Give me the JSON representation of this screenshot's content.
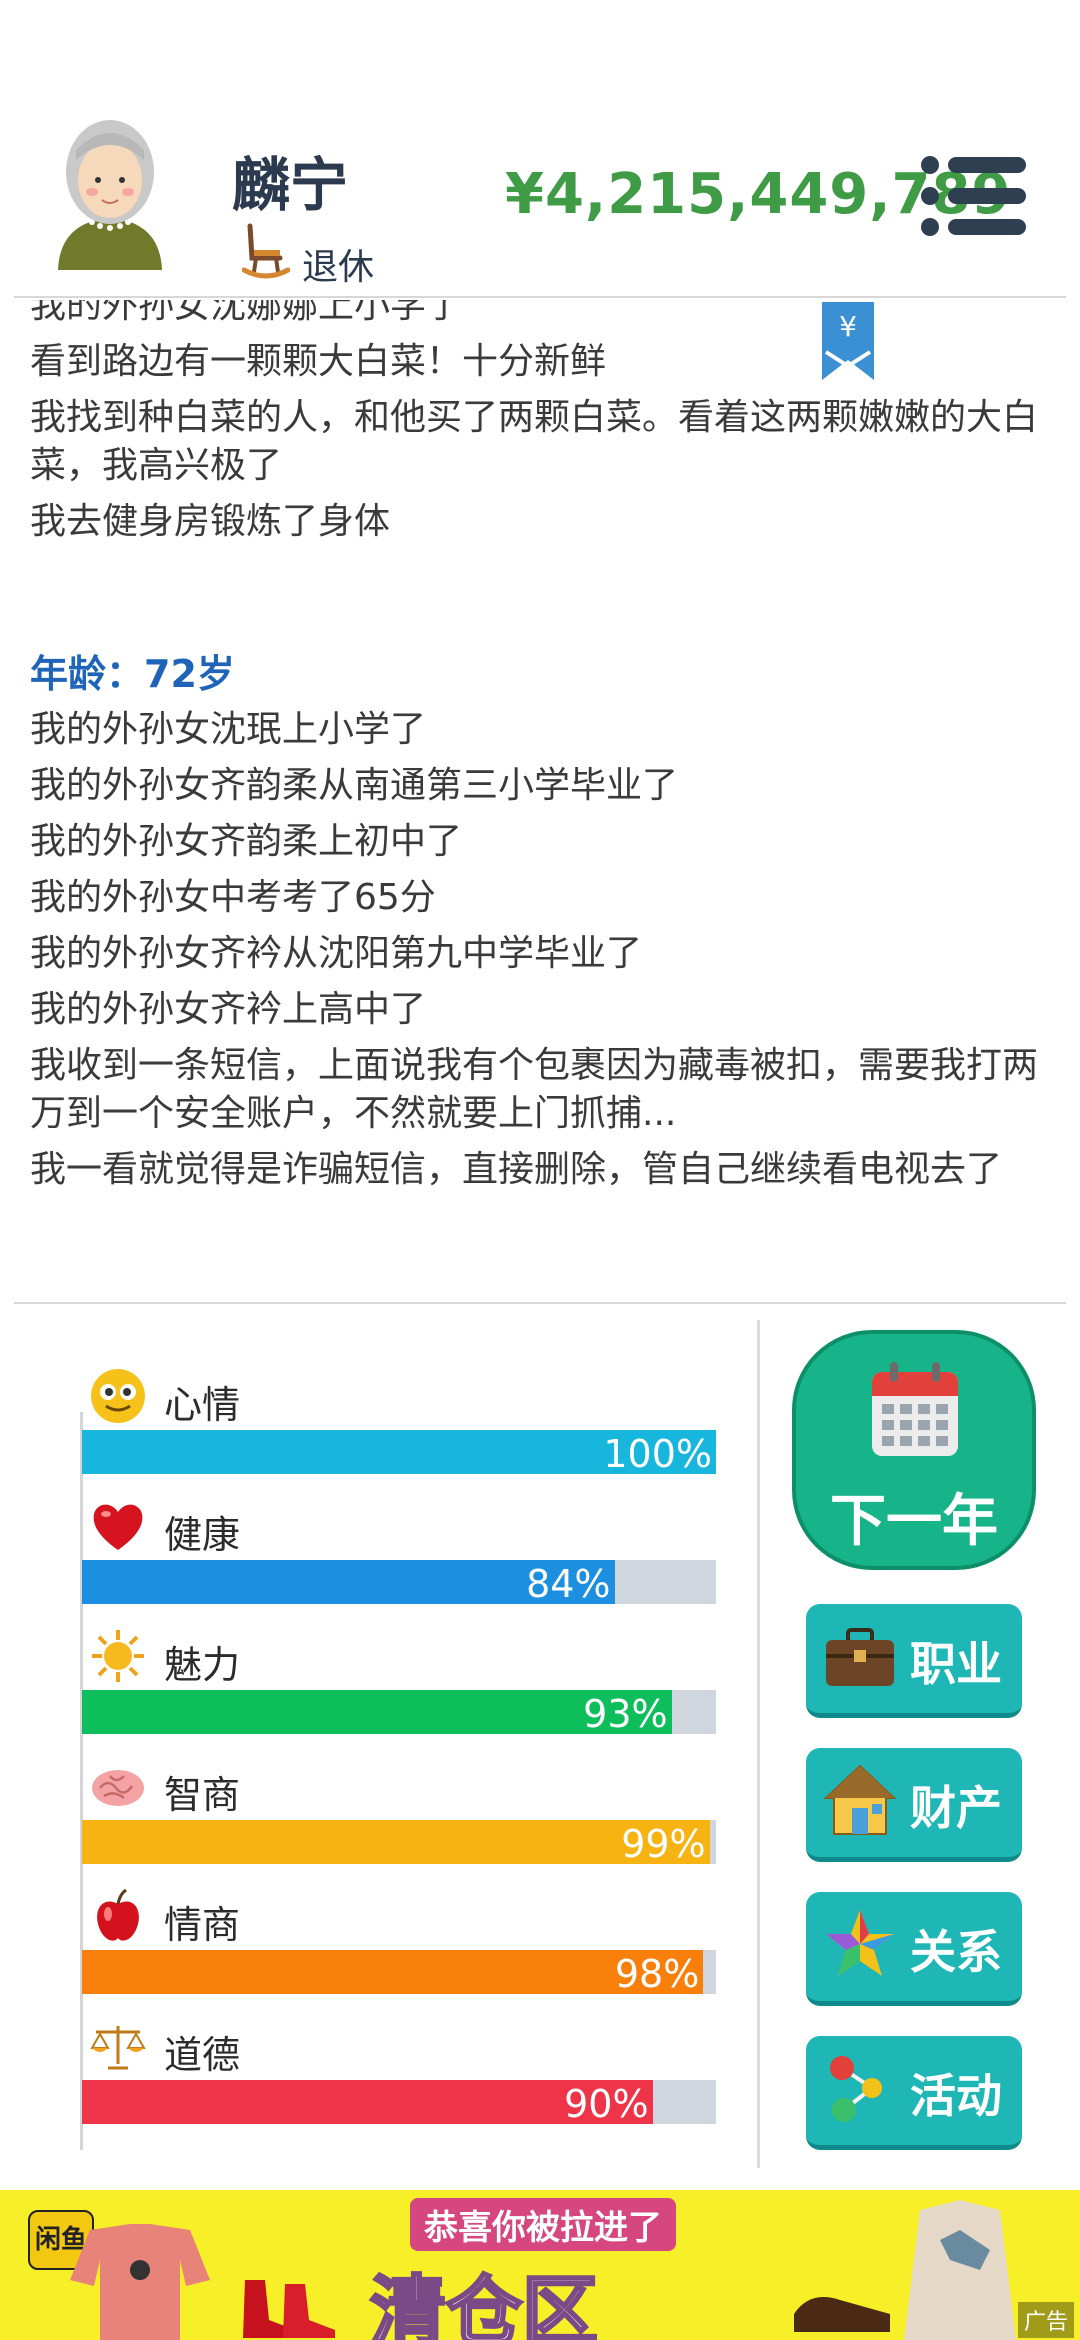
{
  "header": {
    "username": "麟宁",
    "status": "退休",
    "money": "¥4,215,449,789"
  },
  "bookmark": {
    "symbol": "¥"
  },
  "log": {
    "lines_top": [
      "我的外孙女沈娜娜上小学了",
      "看到路边有一颗颗大白菜！十分新鲜",
      "我找到种白菜的人，和他买了两颗白菜。看着这两颗嫩嫩的大白菜，我高兴极了",
      "我去健身房锻炼了身体"
    ],
    "age_heading": "年龄：72岁",
    "lines_bottom": [
      "我的外孙女沈珉上小学了",
      "我的外孙女齐韵柔从南通第三小学毕业了",
      "我的外孙女齐韵柔上初中了",
      "我的外孙女中考考了65分",
      "我的外孙女齐衿从沈阳第九中学毕业了",
      "我的外孙女齐衿上高中了",
      "我收到一条短信，上面说我有个包裹因为藏毒被扣，需要我打两万到一个安全账户，不然就要上门抓捕...",
      "我一看就觉得是诈骗短信，直接删除，管自己继续看电视去了"
    ]
  },
  "stats": [
    {
      "name": "心情",
      "value": 100,
      "label": "100%",
      "color": "#17b7dd",
      "icon": "smiley-icon"
    },
    {
      "name": "健康",
      "value": 84,
      "label": "84%",
      "color": "#1c8fe0",
      "icon": "heart-icon"
    },
    {
      "name": "魅力",
      "value": 93,
      "label": "93%",
      "color": "#0dbe5a",
      "icon": "sun-icon"
    },
    {
      "name": "智商",
      "value": 99,
      "label": "99%",
      "color": "#f7b312",
      "icon": "brain-icon"
    },
    {
      "name": "情商",
      "value": 98,
      "label": "98%",
      "color": "#f97f0b",
      "icon": "apple-icon"
    },
    {
      "name": "道德",
      "value": 90,
      "label": "90%",
      "color": "#ef3449",
      "icon": "scales-icon"
    }
  ],
  "buttons": {
    "next_year": "下一年",
    "career": "职业",
    "assets": "财产",
    "relations": "关系",
    "activities": "活动"
  },
  "ad": {
    "logo": "闲鱼",
    "headline": "恭喜你被拉进了",
    "main": "清仓区",
    "tag": "广告"
  }
}
